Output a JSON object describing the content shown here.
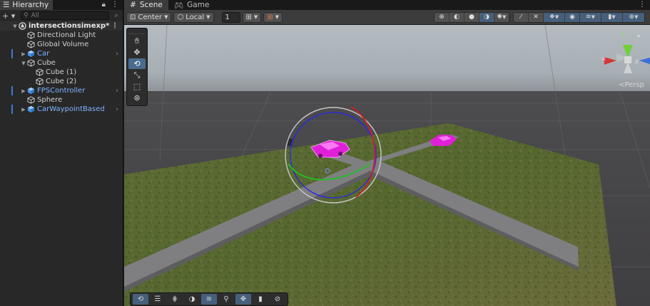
{
  "hierarchy": {
    "tab_label": "Hierarchy",
    "search_placeholder": "All",
    "scene_name": "intersectionsimexp*",
    "items": [
      {
        "label": "Directional Light"
      },
      {
        "label": "Global Volume"
      },
      {
        "label": "Car"
      },
      {
        "label": "Cube"
      },
      {
        "label": "Cube (1)"
      },
      {
        "label": "Cube (2)"
      },
      {
        "label": "FPSController"
      },
      {
        "label": "Sphere"
      },
      {
        "label": "CarWaypointBased"
      }
    ]
  },
  "scene_view": {
    "tabs": [
      {
        "label": "Scene"
      },
      {
        "label": "Game"
      }
    ],
    "toolbar": {
      "pivot_label": "Center",
      "space_label": "Local",
      "snap_value": "1"
    },
    "perspective_label": "<Persp",
    "gizmo_axes": {
      "x": "x",
      "y": "y",
      "z": "z"
    }
  },
  "colors": {
    "accent": "#3f7ad6",
    "prefab_text": "#7fb5ff",
    "sky_top": "#aab4bc",
    "ground": "#4a4a4c",
    "grass": "#5d6a36",
    "road": "#7c7c7e",
    "car": "#e020d8"
  },
  "icons": {
    "hierarchy_tab": "list-icon",
    "scene_tab": "grid-icon",
    "game_tab": "gamepad-icon",
    "tools": [
      "hand-icon",
      "move-icon",
      "rotate-icon",
      "scale-icon",
      "rect-icon",
      "transform-icon"
    ]
  }
}
